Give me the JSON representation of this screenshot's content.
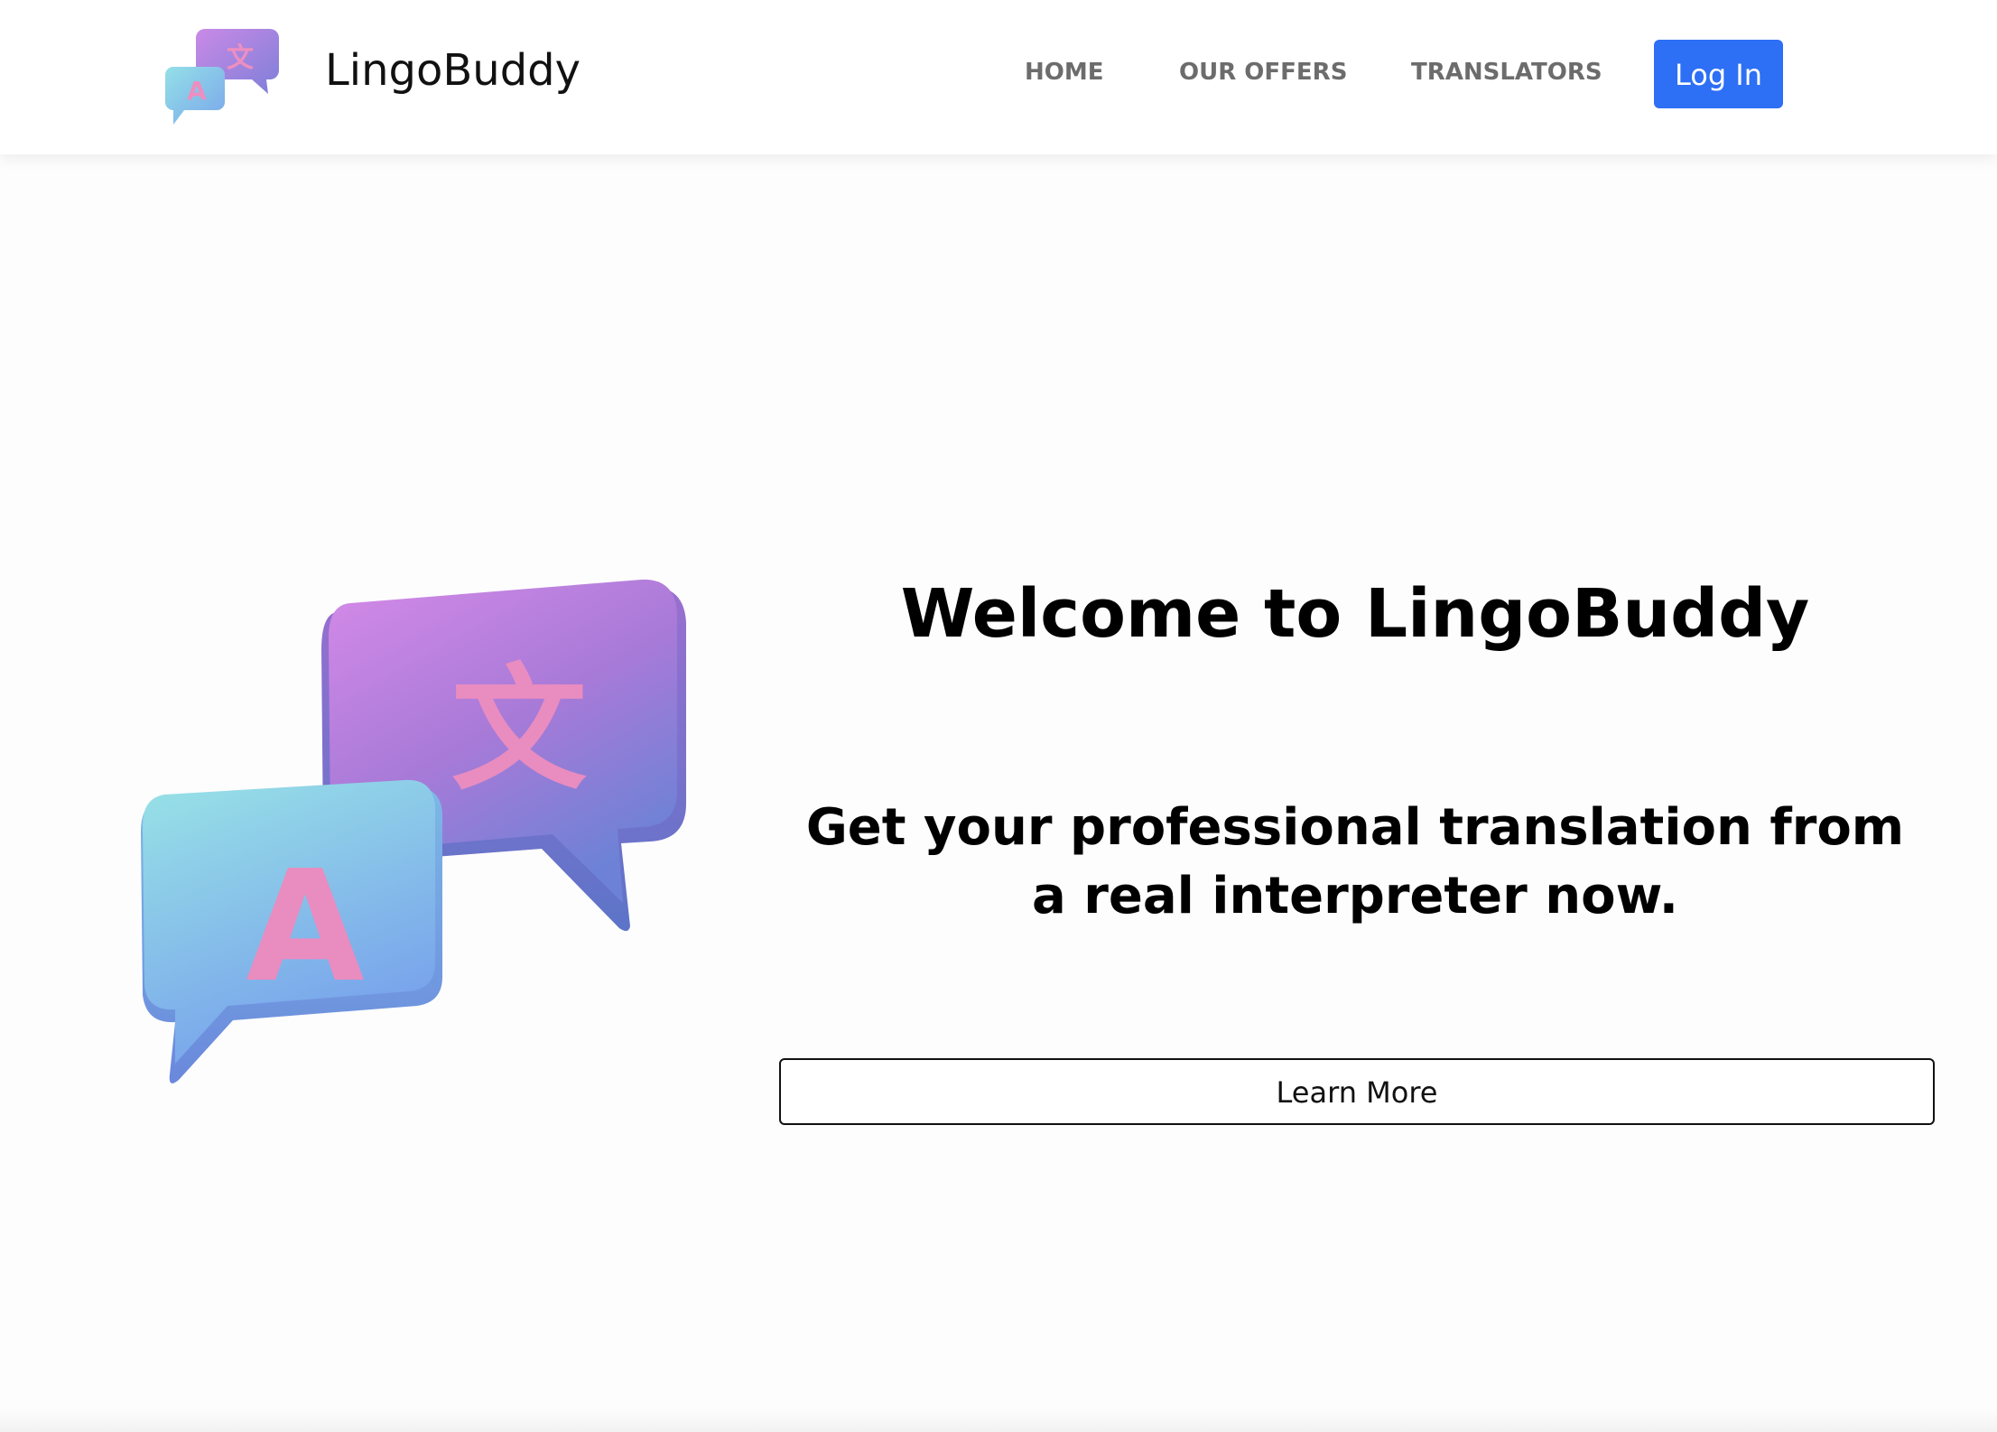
{
  "brand": {
    "name": "LingoBuddy",
    "logo_icon": "translate-bubbles-icon"
  },
  "nav": {
    "items": [
      {
        "label": "HOME"
      },
      {
        "label": "OUR OFFERS"
      },
      {
        "label": "TRANSLATORS"
      }
    ],
    "login_label": "Log In"
  },
  "hero": {
    "illustration_icon": "translate-bubbles-illustration",
    "title": "Welcome to LingoBuddy",
    "subtitle": "Get your professional translation from a real interpreter now.",
    "cta_label": "Learn More"
  },
  "colors": {
    "accent": "#2d6ff5",
    "nav_text": "#6c6c6c",
    "bubble_purple": "#b77be0",
    "bubble_teal": "#8fdce6",
    "glyph_pink": "#ec8fc0"
  }
}
